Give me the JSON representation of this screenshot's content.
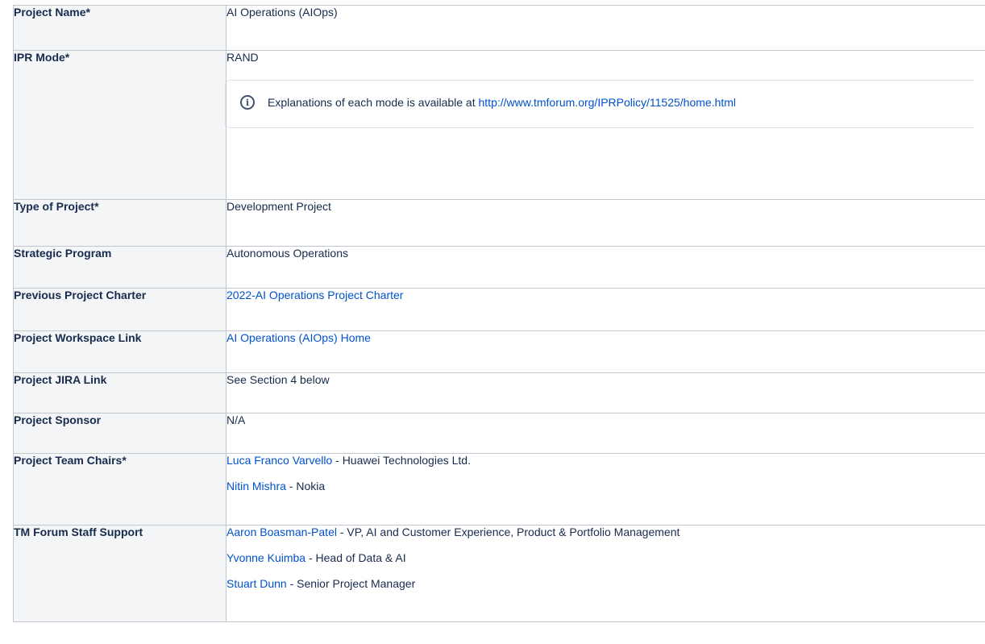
{
  "rows": {
    "project_name": {
      "label": "Project Name*",
      "value": "AI Operations (AIOps)"
    },
    "ipr_mode": {
      "label": "IPR Mode*",
      "value": "RAND",
      "info_text": "Explanations of each mode is available at ",
      "info_link": "http://www.tmforum.org/IPRPolicy/11525/home.html",
      "info_icon": "info-icon"
    },
    "type_of_project": {
      "label": "Type of Project*",
      "value": "Development Project"
    },
    "strategic_program": {
      "label": "Strategic Program",
      "value": "Autonomous Operations"
    },
    "previous_charter": {
      "label": "Previous Project Charter",
      "link": "2022-AI Operations Project Charter"
    },
    "workspace_link": {
      "label": "Project Workspace Link",
      "link": "AI Operations (AIOps) Home"
    },
    "jira_link": {
      "label": "Project JIRA Link",
      "value": "See Section 4 below"
    },
    "sponsor": {
      "label": "Project Sponsor",
      "value": "N/A"
    },
    "team_chairs": {
      "label": "Project Team Chairs*",
      "people": [
        {
          "name": "Luca Franco Varvello",
          "role": " - Huawei Technologies Ltd."
        },
        {
          "name": "Nitin Mishra",
          "role": " - Nokia"
        }
      ]
    },
    "staff_support": {
      "label": "TM Forum Staff Support",
      "people": [
        {
          "name": "Aaron Boasman-Patel",
          "role": " - VP, AI and Customer Experience, Product & Portfolio Management"
        },
        {
          "name": "Yvonne Kuimba",
          "role": "  - Head of Data & AI"
        },
        {
          "name": "Stuart Dunn",
          "role": " - Senior Project Manager"
        }
      ]
    }
  },
  "colors": {
    "link": "#0052cc",
    "header_bg": "#f4f5f7",
    "border": "#c1c7d0",
    "text": "#172b4d"
  }
}
